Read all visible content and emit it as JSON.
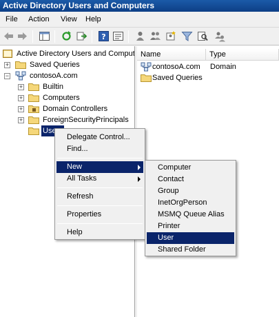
{
  "window": {
    "title": "Active Directory Users and Computers"
  },
  "menubar": {
    "items": [
      "File",
      "Action",
      "View",
      "Help"
    ]
  },
  "toolbar": {
    "icons": [
      "back-icon",
      "forward-icon",
      "console-tree-icon",
      "refresh-icon",
      "export-icon",
      "help-icon",
      "properties-icon",
      "users-icon",
      "group-icon",
      "filter-icon",
      "find-icon",
      "delegate-icon"
    ]
  },
  "tree": {
    "root": "Active Directory Users and Computers",
    "saved_queries": "Saved Queries",
    "domain": "contosoA.com",
    "children": [
      "Builtin",
      "Computers",
      "Domain Controllers",
      "ForeignSecurityPrincipals",
      "Users"
    ]
  },
  "list": {
    "columns": [
      "Name",
      "Type"
    ],
    "rows": [
      {
        "name": "contosoA.com",
        "type": "Domain"
      },
      {
        "name": "Saved Queries",
        "type": ""
      }
    ]
  },
  "context_menu": {
    "items": [
      "Delegate Control...",
      "Find...",
      "New",
      "All Tasks",
      "Refresh",
      "Properties",
      "Help"
    ],
    "highlighted": "New"
  },
  "submenu": {
    "items": [
      "Computer",
      "Contact",
      "Group",
      "InetOrgPerson",
      "MSMQ Queue Alias",
      "Printer",
      "User",
      "Shared Folder"
    ],
    "highlighted": "User"
  },
  "colors": {
    "highlight": "#0a246a",
    "titlebar": "#1b5aa8",
    "folder": "#f5d77a"
  }
}
